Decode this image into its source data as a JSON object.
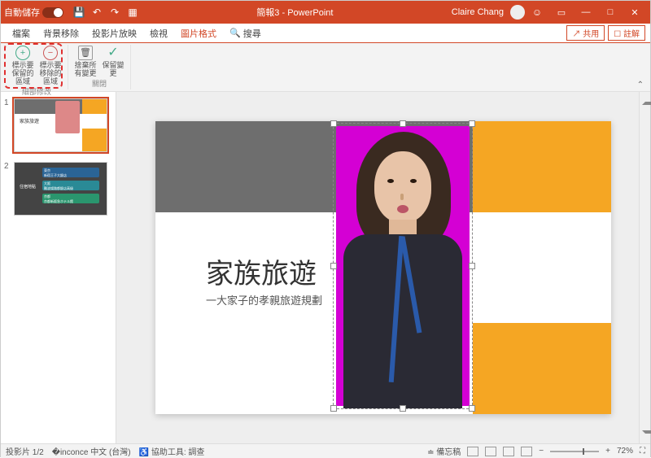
{
  "titlebar": {
    "autosave_label": "自動儲存",
    "autosave_state": "關閉",
    "doc_title": "簡報3 - PowerPoint",
    "user_name": "Claire Chang"
  },
  "tabs": {
    "file": "檔案",
    "bgremove": "背景移除",
    "slideshow": "投影片放映",
    "view": "檢視",
    "picformat": "圖片格式",
    "search_icon": "search-icon",
    "search": "搜尋",
    "share": "共用",
    "comments": "註解"
  },
  "ribbon": {
    "mark_keep": "標示要保留的區域",
    "mark_remove": "標示要移除的區域",
    "group1_label": "細部修改",
    "discard": "捨棄所有變更",
    "keep": "保留變更",
    "group2_label": "關閉"
  },
  "thumbs": {
    "n1": "1",
    "n2": "2",
    "s1_title": "家族旅遊",
    "s2_lbl": "住宿地點",
    "s2_i1a": "東京",
    "s2_i1b": "新宿王子大飯店",
    "s2_i2a": "大阪",
    "s2_i2b": "難波燦路都飯店高級",
    "s2_i3a": "京都",
    "s2_i3b": "京都新阪急ホテル館"
  },
  "slide": {
    "title": "家族旅遊",
    "subtitle": "一大家子的孝親旅遊規劃"
  },
  "statusbar": {
    "slide_count": "投影片 1/2",
    "lang": "中文 (台灣)",
    "a11y": "協助工具: 調查",
    "notes": "備忘稿",
    "zoom": "72%"
  }
}
